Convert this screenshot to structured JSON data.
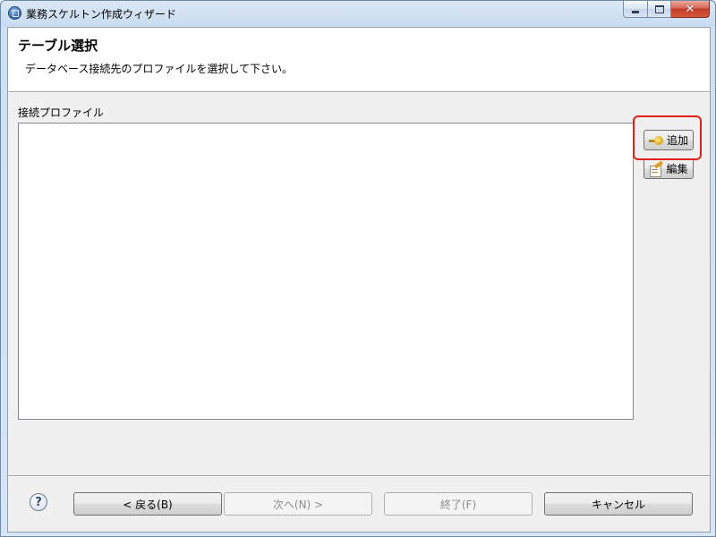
{
  "window": {
    "title": "業務スケルトン作成ウィザード",
    "minimize_symbol": "",
    "maximize_symbol": "",
    "close_symbol": "✕"
  },
  "header": {
    "title": "テーブル選択",
    "description": "データベース接続先のプロファイルを選択して下さい。"
  },
  "profile": {
    "label": "接続プロファイル",
    "items": []
  },
  "buttons": {
    "add": "追加",
    "edit": "編集",
    "help": "?",
    "back": "< 戻る(B)",
    "next": "次へ(N) >",
    "finish": "終了(F)",
    "cancel": "キャンセル"
  },
  "icons": {
    "title": "wizard-app-icon",
    "add": "add-connection-icon",
    "edit": "edit-document-icon",
    "help": "help-icon"
  },
  "colors": {
    "highlight": "#e0201a",
    "close_button": "#c23a25"
  }
}
